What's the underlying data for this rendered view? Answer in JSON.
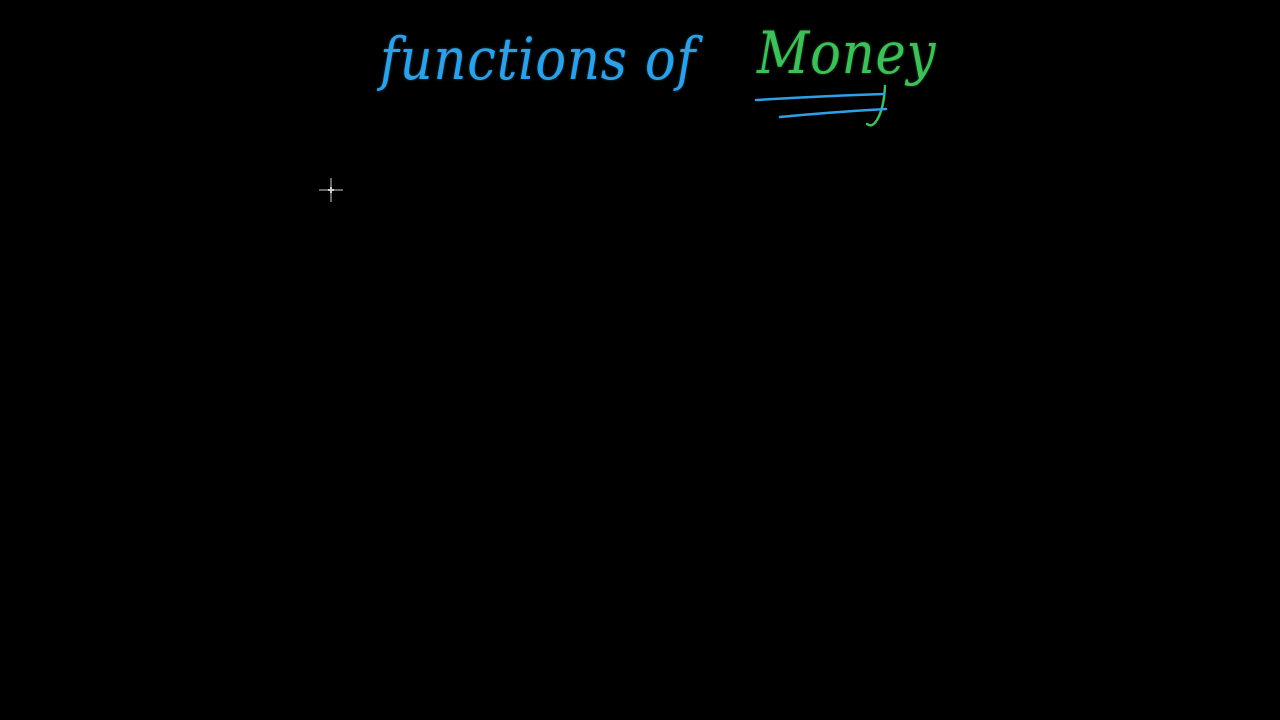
{
  "board": {
    "background_color": "#000000",
    "title_part1": "functions of",
    "title_part2": "Money",
    "title_part1_color": "#2f9fe6",
    "title_part2_color": "#3fbf5a",
    "underline_color": "#2f9fe6"
  },
  "cursor": {
    "icon": "crosshair-cursor-icon"
  }
}
